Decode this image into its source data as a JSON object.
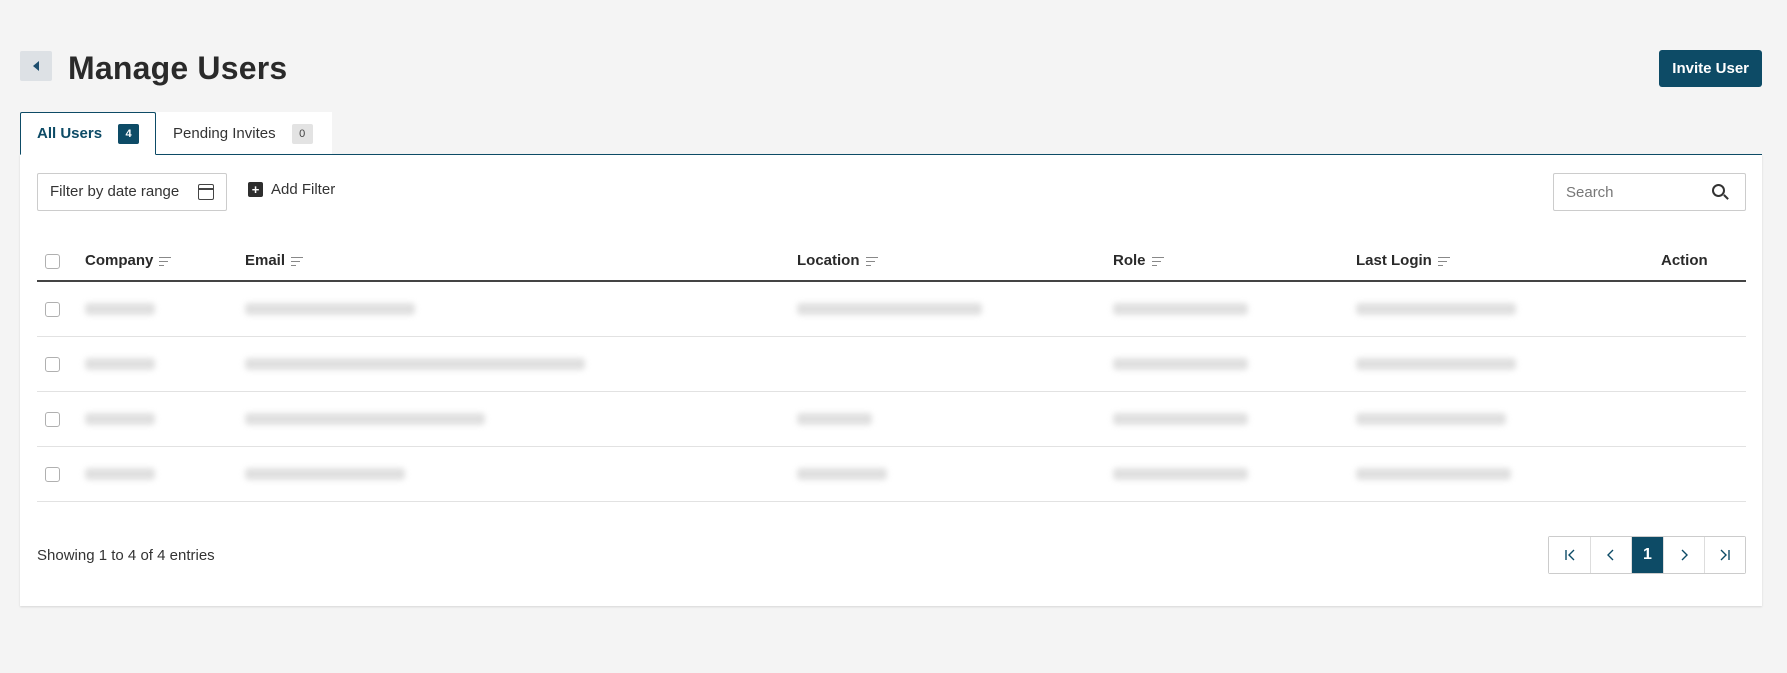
{
  "header": {
    "title": "Manage Users",
    "invite_label": "Invite User"
  },
  "tabs": [
    {
      "label": "All Users",
      "count": "4"
    },
    {
      "label": "Pending Invites",
      "count": "0"
    }
  ],
  "toolbar": {
    "date_filter_label": "Filter by date range",
    "add_filter_label": "Add Filter",
    "search_placeholder": "Search"
  },
  "table": {
    "columns": [
      "Company",
      "Email",
      "Location",
      "Role",
      "Last Login",
      "Action"
    ],
    "rows": [
      {
        "company_redacted": true,
        "email_redacted": true,
        "location_redacted": true,
        "role_redacted": true,
        "last_login_redacted": true
      },
      {
        "company_redacted": true,
        "email_redacted": true,
        "location_redacted": false,
        "role_redacted": true,
        "last_login_redacted": true
      },
      {
        "company_redacted": true,
        "email_redacted": true,
        "location_redacted": true,
        "role_redacted": true,
        "last_login_redacted": true
      },
      {
        "company_redacted": true,
        "email_redacted": true,
        "location_redacted": true,
        "role_redacted": true,
        "last_login_redacted": true
      }
    ]
  },
  "footer": {
    "showing_prefix": "Showing",
    "from": "1",
    "to_word": "to",
    "to": "4",
    "of_word": "of",
    "total": "4",
    "suffix": "entries"
  },
  "pagination": {
    "first": "|<",
    "prev": "<",
    "current_page": "1",
    "next": ">",
    "last": ">|"
  },
  "colors": {
    "primary": "#0d4b66",
    "background": "#f4f4f4"
  }
}
